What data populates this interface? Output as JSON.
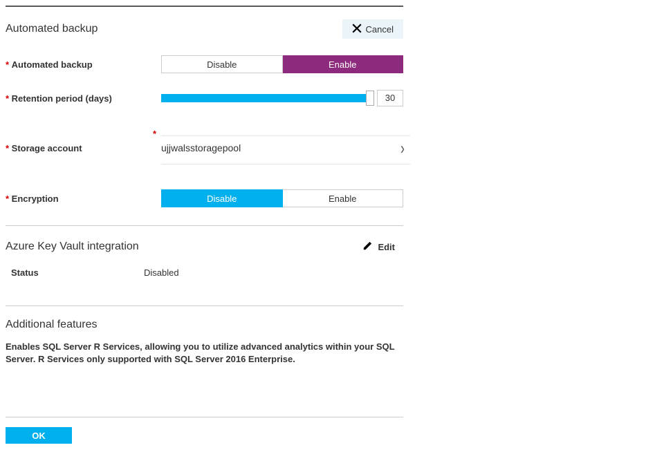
{
  "automated_backup": {
    "section_title": "Automated backup",
    "cancel_label": "Cancel",
    "labels": {
      "automated_backup": "Automated backup",
      "retention_period": "Retention period (days)",
      "storage_account": "Storage account",
      "encryption": "Encryption"
    },
    "toggle": {
      "disable": "Disable",
      "enable": "Enable",
      "selected": "Enable"
    },
    "retention_days": "30",
    "storage_account_value": "ujjwalsstoragepool",
    "encryption_toggle": {
      "disable": "Disable",
      "enable": "Enable",
      "selected": "Disable"
    }
  },
  "akv": {
    "section_title": "Azure Key Vault integration",
    "edit_label": "Edit",
    "status_label": "Status",
    "status_value": "Disabled"
  },
  "additional_features": {
    "section_title": "Additional features",
    "description": "Enables SQL Server R Services, allowing you to utilize advanced analytics within your SQL Server. R Services only supported with SQL Server 2016 Enterprise."
  },
  "footer": {
    "ok_label": "OK"
  }
}
